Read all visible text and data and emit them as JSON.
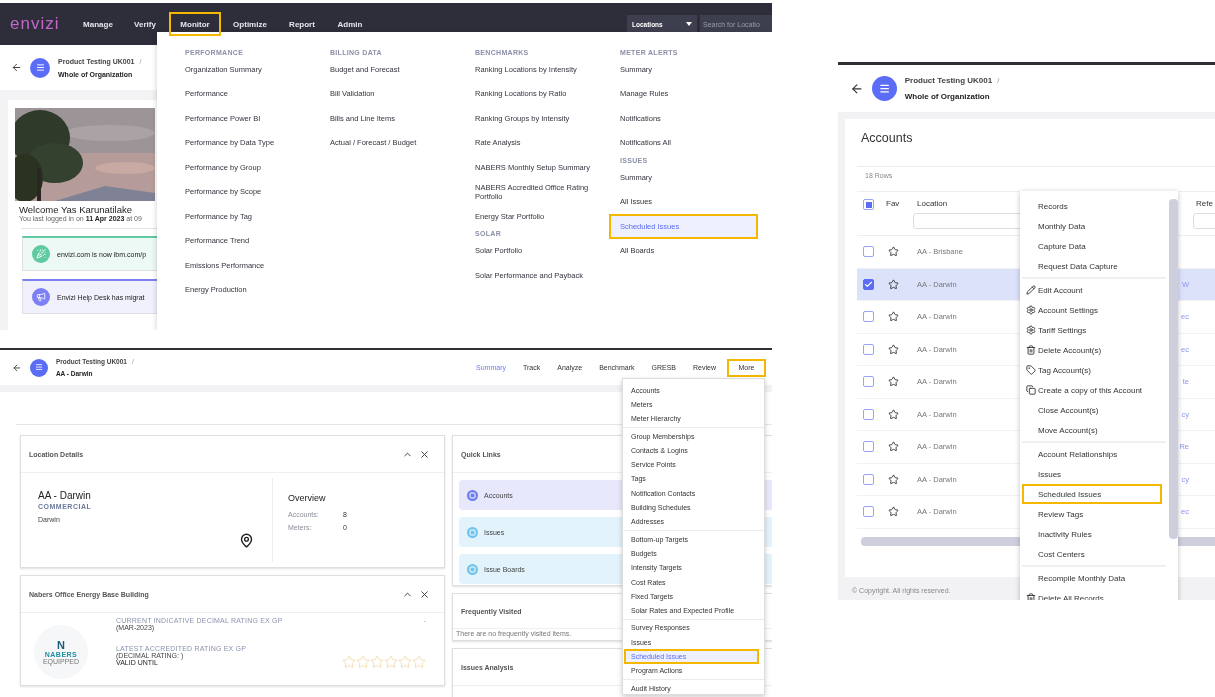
{
  "monitor_screen": {
    "logo": "envizi",
    "nav": [
      {
        "label": "Manage",
        "highlighted": false
      },
      {
        "label": "Verify",
        "highlighted": false
      },
      {
        "label": "Monitor",
        "highlighted": true
      },
      {
        "label": "Optimize",
        "highlighted": false
      },
      {
        "label": "Report",
        "highlighted": false
      },
      {
        "label": "Admin",
        "highlighted": false
      }
    ],
    "location_select": "Locations",
    "search_placeholder": "Search for Locatio",
    "breadcrumb": {
      "parent": "Product Testing UK001",
      "separator": "/",
      "current": "Whole of Organization"
    },
    "welcome": {
      "title": "Welcome Yas Karunatilake",
      "subtitle": "You last logged in on **11 Apr 2023** at 09"
    },
    "banners": [
      {
        "text": "envizi.com is now ibm.com/p",
        "kind": "party",
        "color": "#5fcaa0"
      },
      {
        "text": "Envizi Help Desk has migrat",
        "kind": "megaphone",
        "color": "#7d80f2"
      }
    ],
    "menu": [
      {
        "sections": [
          {
            "heading": "PERFORMANCE",
            "items": [
              {
                "label": "Organization Summary",
                "selected": false,
                "highlighted": false
              },
              {
                "label": "Performance",
                "selected": false,
                "highlighted": false
              },
              {
                "label": "Performance Power BI",
                "selected": false,
                "highlighted": false
              },
              {
                "label": "Performance by Data Type",
                "selected": false,
                "highlighted": false
              },
              {
                "label": "Performance by Group",
                "selected": false,
                "highlighted": false
              },
              {
                "label": "Performance by Scope",
                "selected": false,
                "highlighted": false
              },
              {
                "label": "Performance by Tag",
                "selected": false,
                "highlighted": false
              },
              {
                "label": "Performance Trend",
                "selected": false,
                "highlighted": false
              },
              {
                "label": "Emissions Performance",
                "selected": false,
                "highlighted": false
              },
              {
                "label": "Energy Production",
                "selected": false,
                "highlighted": false
              }
            ]
          }
        ]
      },
      {
        "sections": [
          {
            "heading": "BILLING DATA",
            "items": [
              {
                "label": "Budget and Forecast",
                "selected": false,
                "highlighted": false
              },
              {
                "label": "Bill Validation",
                "selected": false,
                "highlighted": false
              },
              {
                "label": "Bills and Line Items",
                "selected": false,
                "highlighted": false
              },
              {
                "label": "Actual / Forecast / Budget",
                "selected": false,
                "highlighted": false
              }
            ]
          }
        ]
      },
      {
        "sections": [
          {
            "heading": "BENCHMARKS",
            "items": [
              {
                "label": "Ranking Locations by Intensity",
                "selected": false,
                "highlighted": false
              },
              {
                "label": "Ranking Locations by Ratio",
                "selected": false,
                "highlighted": false
              },
              {
                "label": "Ranking Groups by Intensity",
                "selected": false,
                "highlighted": false
              },
              {
                "label": "Rate Analysis",
                "selected": false,
                "highlighted": false
              },
              {
                "label": "NABERS Monthly Setup Summary",
                "selected": false,
                "highlighted": false
              },
              {
                "label": "NABERS Accredited Office Rating Portfolio",
                "selected": false,
                "highlighted": false
              },
              {
                "label": "Energy Star Portfolio",
                "selected": false,
                "highlighted": false
              }
            ]
          },
          {
            "heading": "SOLAR",
            "items": [
              {
                "label": "Solar Portfolio",
                "selected": false,
                "highlighted": false
              },
              {
                "label": "Solar Performance and Payback",
                "selected": false,
                "highlighted": false
              }
            ]
          }
        ]
      },
      {
        "sections": [
          {
            "heading": "METER ALERTS",
            "items": [
              {
                "label": "Summary",
                "selected": false,
                "highlighted": false
              },
              {
                "label": "Manage Rules",
                "selected": false,
                "highlighted": false
              },
              {
                "label": "Notifications",
                "selected": false,
                "highlighted": false
              },
              {
                "label": "Notifications All",
                "selected": false,
                "highlighted": false
              }
            ]
          },
          {
            "heading": "ISSUES",
            "items": [
              {
                "label": "Summary",
                "selected": false,
                "highlighted": false
              },
              {
                "label": "All Issues",
                "selected": false,
                "highlighted": false
              },
              {
                "label": "Scheduled Issues",
                "selected": true,
                "highlighted": true
              },
              {
                "label": "All Boards",
                "selected": false,
                "highlighted": false
              }
            ]
          }
        ]
      }
    ]
  },
  "location_screen": {
    "breadcrumb": {
      "parent": "Product Testing UK001",
      "separator": "/",
      "current": "AA - Darwin"
    },
    "tabs": [
      {
        "label": "Summary",
        "selected": true,
        "highlighted": false
      },
      {
        "label": "Track",
        "selected": false,
        "highlighted": false
      },
      {
        "label": "Analyze",
        "selected": false,
        "highlighted": false
      },
      {
        "label": "Benchmark",
        "selected": false,
        "highlighted": false
      },
      {
        "label": "GRESB",
        "selected": false,
        "highlighted": false
      },
      {
        "label": "Review",
        "selected": false,
        "highlighted": false
      },
      {
        "label": "More",
        "selected": false,
        "highlighted": true
      }
    ],
    "location_details": {
      "title": "Location Details",
      "name": "AA - Darwin",
      "type": "COMMERCIAL",
      "city": "Darwin",
      "overview_title": "Overview",
      "stats": [
        {
          "label": "Accounts:",
          "value": "8"
        },
        {
          "label": "Meters:",
          "value": "0"
        }
      ]
    },
    "nabers": {
      "title": "Nabers Office Energy Base Building",
      "logo": {
        "mark": "N",
        "name": "NABERS",
        "tag": "EQUIPPED"
      },
      "current_label": "CURRENT INDICATIVE DECIMAL RATING EX GP",
      "current_period": "(MAR-2023)",
      "current_value": "-",
      "latest_label": "LATEST ACCREDITED RATING EX GP",
      "latest_sub": "(DECIMAL RATING: )",
      "valid_until": "VALID UNTIL",
      "stars": 0
    },
    "quick_links": {
      "title": "Quick Links",
      "items": [
        {
          "label": "Accounts",
          "color": "#e7e8fc"
        },
        {
          "label": "Issues",
          "color": "#e2f3fb"
        },
        {
          "label": "Issue Boards",
          "color": "#e2f3fb"
        }
      ]
    },
    "frequently_visited": {
      "title": "Frequently Visited",
      "empty_text": "There are no frequently visited items."
    },
    "issues_analysis": {
      "title": "Issues Analysis"
    },
    "more_menu": [
      [
        {
          "label": "Accounts",
          "selected": false,
          "highlighted": false
        },
        {
          "label": "Meters",
          "selected": false,
          "highlighted": false
        },
        {
          "label": "Meter Hierarchy",
          "selected": false,
          "highlighted": false
        }
      ],
      [
        {
          "label": "Group Memberships",
          "selected": false,
          "highlighted": false
        },
        {
          "label": "Contacts & Logins",
          "selected": false,
          "highlighted": false
        },
        {
          "label": "Service Points",
          "selected": false,
          "highlighted": false
        },
        {
          "label": "Tags",
          "selected": false,
          "highlighted": false
        },
        {
          "label": "Notification Contacts",
          "selected": false,
          "highlighted": false
        },
        {
          "label": "Building Schedules",
          "selected": false,
          "highlighted": false
        },
        {
          "label": "Addresses",
          "selected": false,
          "highlighted": false
        }
      ],
      [
        {
          "label": "Bottom-up Targets",
          "selected": false,
          "highlighted": false
        },
        {
          "label": "Budgets",
          "selected": false,
          "highlighted": false
        },
        {
          "label": "Intensity Targets",
          "selected": false,
          "highlighted": false
        },
        {
          "label": "Cost Rates",
          "selected": false,
          "highlighted": false
        },
        {
          "label": "Fixed Targets",
          "selected": false,
          "highlighted": false
        },
        {
          "label": "Solar Rates and Expected Profile",
          "selected": false,
          "highlighted": false
        }
      ],
      [
        {
          "label": "Survey Responses",
          "selected": false,
          "highlighted": false
        },
        {
          "label": "Issues",
          "selected": false,
          "highlighted": false
        },
        {
          "label": "Scheduled Issues",
          "selected": true,
          "highlighted": true
        },
        {
          "label": "Program Actions",
          "selected": false,
          "highlighted": false
        }
      ],
      [
        {
          "label": "Audit History",
          "selected": false,
          "highlighted": false
        }
      ]
    ]
  },
  "accounts_screen": {
    "breadcrumb": {
      "parent": "Product Testing UK001",
      "separator": "/",
      "current": "Whole of Organization"
    },
    "title": "Accounts",
    "row_count": "18 Rows",
    "select_all": {
      "indeterminate": true
    },
    "columns": {
      "fav": "Fav",
      "location": "Location",
      "column_5": "Refe"
    },
    "rows": [
      {
        "location": "AA - Brisbane",
        "column_4": "",
        "checked": false,
        "selected": false
      },
      {
        "location": "AA - Darwin",
        "column_4": "W",
        "checked": true,
        "selected": true
      },
      {
        "location": "AA - Darwin",
        "column_4": "ec",
        "checked": false,
        "selected": false
      },
      {
        "location": "AA - Darwin",
        "column_4": "ec",
        "checked": false,
        "selected": false
      },
      {
        "location": "AA - Darwin",
        "column_4": "te",
        "checked": false,
        "selected": false
      },
      {
        "location": "AA - Darwin",
        "column_4": "cy",
        "checked": false,
        "selected": false
      },
      {
        "location": "AA - Darwin",
        "column_4": "Re",
        "checked": false,
        "selected": false
      },
      {
        "location": "AA - Darwin",
        "column_4": "cy",
        "checked": false,
        "selected": false
      },
      {
        "location": "AA - Darwin",
        "column_4": "ec",
        "checked": false,
        "selected": false
      }
    ],
    "context_menu": [
      [
        {
          "label": "Records",
          "kind": "plain",
          "highlighted": false
        },
        {
          "label": "Monthly Data",
          "kind": "plain",
          "highlighted": false
        },
        {
          "label": "Capture Data",
          "kind": "plain",
          "highlighted": false
        },
        {
          "label": "Request Data Capture",
          "kind": "plain",
          "highlighted": false
        }
      ],
      [
        {
          "label": "Edit Account",
          "kind": "edit",
          "highlighted": false
        },
        {
          "label": "Account Settings",
          "kind": "settings",
          "highlighted": false
        },
        {
          "label": "Tariff Settings",
          "kind": "settings",
          "highlighted": false
        },
        {
          "label": "Delete Account(s)",
          "kind": "delete",
          "highlighted": false
        },
        {
          "label": "Tag Account(s)",
          "kind": "tag",
          "highlighted": false
        },
        {
          "label": "Create a copy of this Account",
          "kind": "copy",
          "highlighted": false
        },
        {
          "label": "Close Account(s)",
          "kind": "plain",
          "highlighted": false
        },
        {
          "label": "Move Account(s)",
          "kind": "plain",
          "highlighted": false
        }
      ],
      [
        {
          "label": "Account Relationships",
          "kind": "plain",
          "highlighted": false
        },
        {
          "label": "Issues",
          "kind": "plain",
          "highlighted": false
        },
        {
          "label": "Scheduled Issues",
          "kind": "plain",
          "highlighted": true
        },
        {
          "label": "Review Tags",
          "kind": "plain",
          "highlighted": false
        },
        {
          "label": "Inactivity Rules",
          "kind": "plain",
          "highlighted": false
        },
        {
          "label": "Cost Centers",
          "kind": "plain",
          "highlighted": false
        }
      ],
      [
        {
          "label": "Recompile Monthly Data",
          "kind": "plain",
          "highlighted": false
        },
        {
          "label": "Delete All Records",
          "kind": "delete",
          "highlighted": false
        }
      ]
    ],
    "footer": "© Copyright. All rights reserved."
  }
}
